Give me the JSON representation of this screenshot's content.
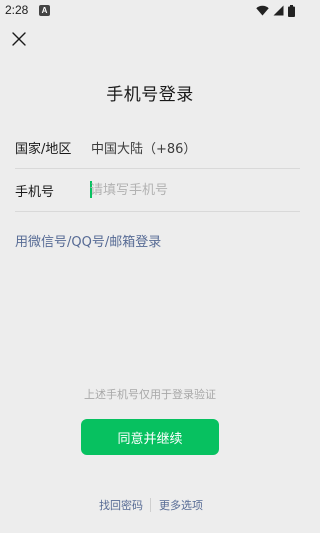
{
  "status_bar": {
    "time": "2:28",
    "app_icon": "A",
    "icons": [
      "wifi-icon",
      "signal-icon",
      "battery-icon"
    ]
  },
  "header": {
    "close_icon": "close-icon",
    "title": "手机号登录"
  },
  "form": {
    "country_label": "国家/地区",
    "country_value": "中国大陆（+86）",
    "phone_label": "手机号",
    "phone_placeholder": "请填写手机号",
    "phone_value": ""
  },
  "alt_login_link": "用微信号/QQ号/邮箱登录",
  "hint": "上述手机号仅用于登录验证",
  "primary_button": "同意并继续",
  "bottom_links": {
    "find_password": "找回密码",
    "more_options": "更多选项"
  },
  "colors": {
    "background": "#ededed",
    "accent_green": "#07c160",
    "link_blue": "#576b95",
    "divider": "#d9d9d9"
  }
}
